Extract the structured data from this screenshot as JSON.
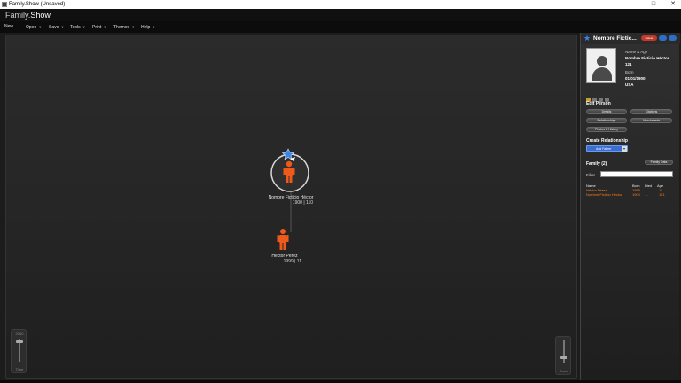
{
  "window": {
    "title": "Family.Show (Unsaved)",
    "minimize": "—",
    "maximize": "□",
    "close": "✕"
  },
  "header": {
    "logo_main": "Family.",
    "logo_accent": "Show"
  },
  "menu": {
    "items": [
      {
        "label": "New",
        "has_caret": false
      },
      {
        "label": "Open",
        "has_caret": true
      },
      {
        "label": "Save",
        "has_caret": true
      },
      {
        "label": "Tools",
        "has_caret": true
      },
      {
        "label": "Print",
        "has_caret": true
      },
      {
        "label": "Themes",
        "has_caret": true
      },
      {
        "label": "Help",
        "has_caret": true
      }
    ]
  },
  "canvas": {
    "nodes": [
      {
        "name": "Nombre Ficticio Héctor",
        "sub": "1900 | 110",
        "selected": true,
        "color": "#ee5a1a"
      },
      {
        "name": "Héctor Pérez",
        "sub": "1999 | 11",
        "selected": false,
        "color": "#ee5a1a"
      }
    ],
    "time_slider": {
      "top_label": "2010",
      "bottom_label": "Time"
    },
    "zoom_slider": {
      "label": "Zoom"
    }
  },
  "panel": {
    "title": "Nombre Fictic...",
    "head_buttons": [
      "Delete",
      "",
      ""
    ],
    "info": {
      "name_age_label": "Name & Age",
      "name": "Nombre Ficticio Héctor",
      "age": "121",
      "born_label": "Born",
      "born_date": "01/01/1900",
      "born_place": "USA"
    },
    "edit_person": {
      "title": "Edit Person",
      "buttons": [
        "Details",
        "Citations",
        "Relationships",
        "Attachments",
        "Photos & History"
      ]
    },
    "create_relationship": {
      "title": "Create Relationship",
      "selected": "Add Father"
    },
    "family": {
      "title": "Family",
      "count": "(2)",
      "family_data_button": "Family Data",
      "filter_label": "Filter",
      "columns": [
        "Name",
        "Born",
        "Died",
        "Age"
      ],
      "rows": [
        {
          "name": "Héctor Pérez",
          "born": "1999",
          "died": "-",
          "age": "11"
        },
        {
          "name": "Nombre Ficticio Héctor",
          "born": "1900",
          "died": "-",
          "age": "121"
        }
      ]
    }
  },
  "colors": {
    "accent_orange": "#ee5a1a",
    "star_blue": "#3a86e8",
    "delete_red": "#c0392b"
  }
}
